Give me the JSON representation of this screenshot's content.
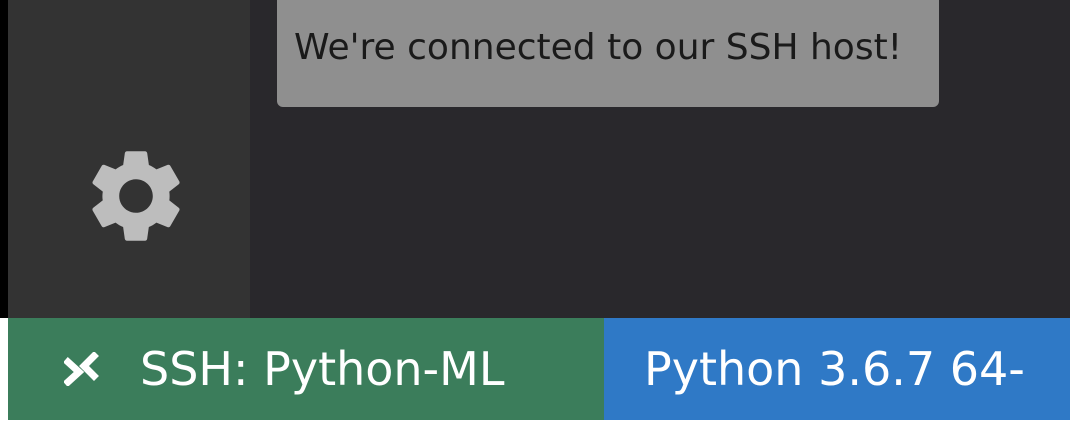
{
  "toast": {
    "message": "We're connected to our SSH host!"
  },
  "activity_bar": {
    "icon": "gear-icon"
  },
  "status_bar": {
    "remote": {
      "label": "SSH: Python-ML",
      "icon": "remote-icon"
    },
    "interpreter": {
      "label": "Python 3.6.7 64-"
    }
  },
  "colors": {
    "activity_bar": "#333333",
    "editor_background": "#29282c",
    "toast_background": "#8f8f8f",
    "remote_background": "#3b7d5b",
    "status_bar_blue": "#2f79c6",
    "icon": "#bdbdbd"
  }
}
